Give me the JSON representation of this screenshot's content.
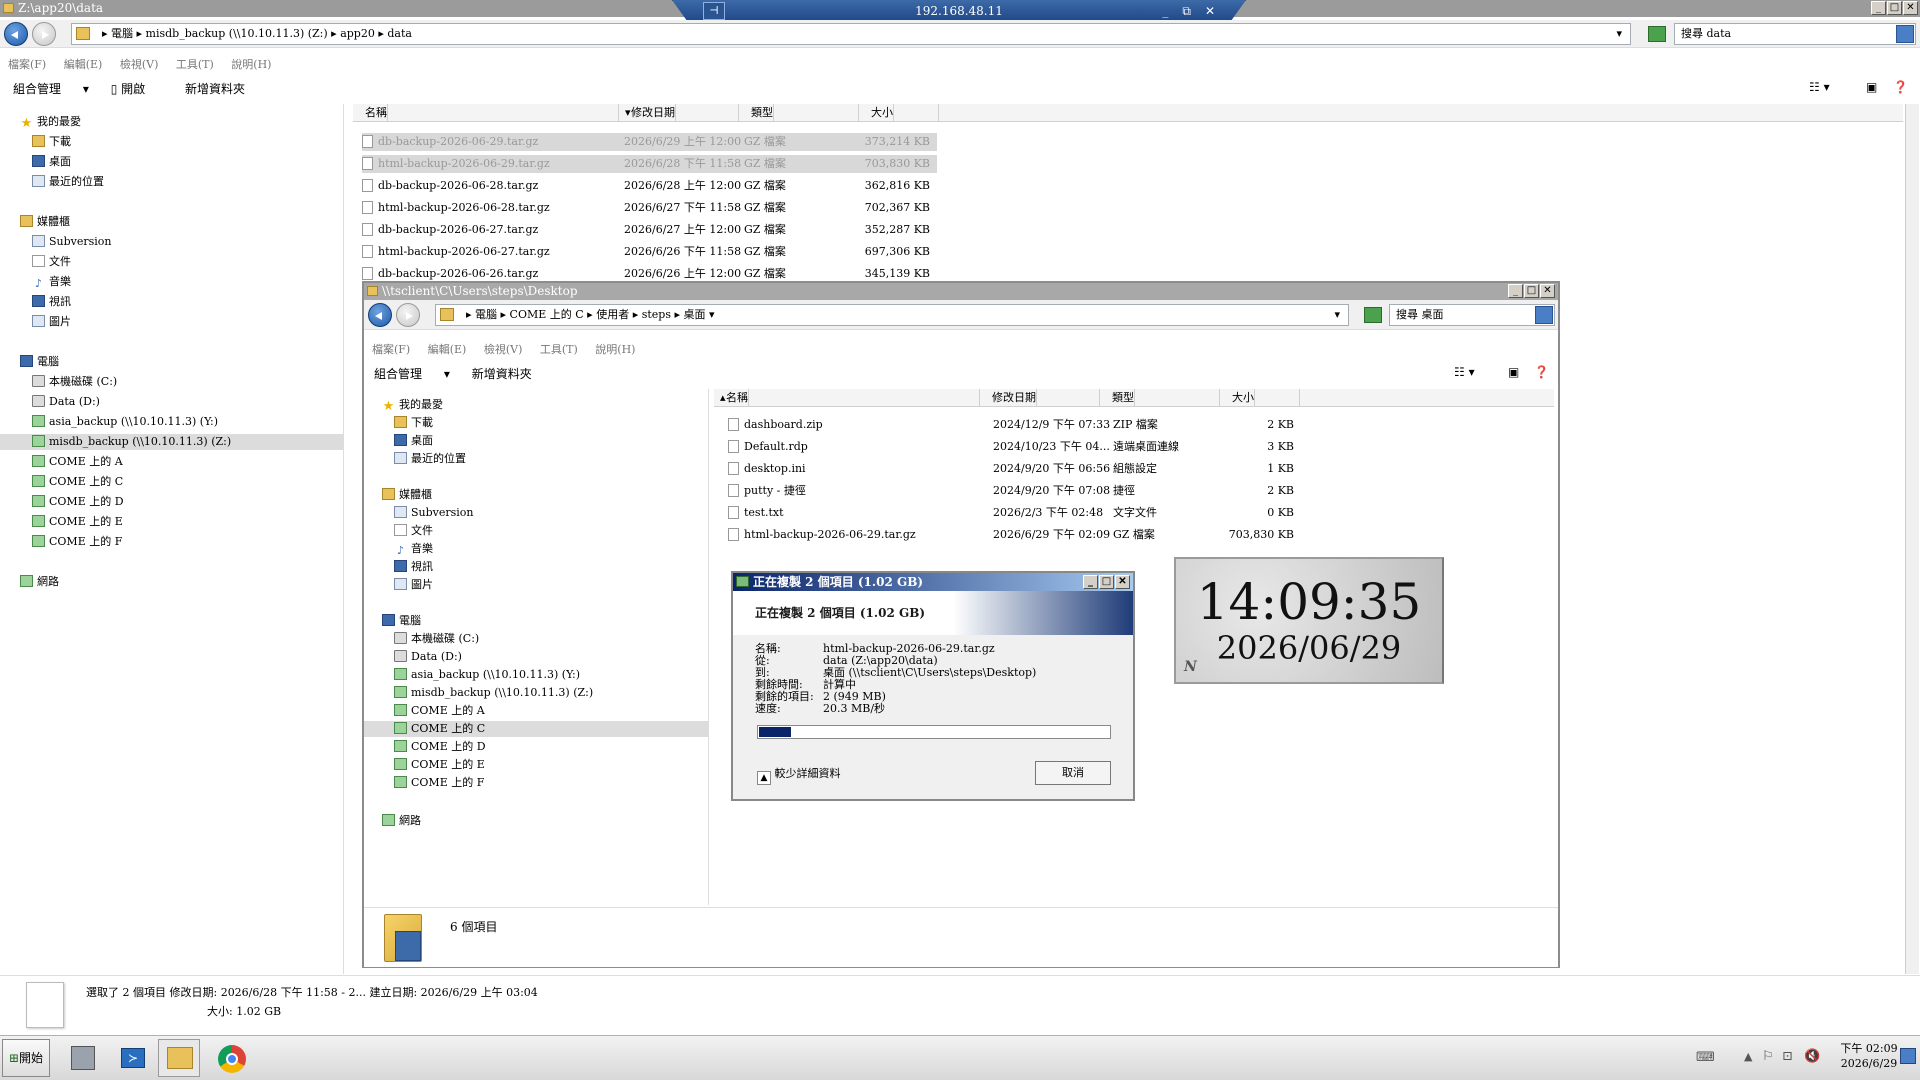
{
  "outer_window": {
    "title": "Z:\\app20\\data",
    "breadcrumb": [
      "電腦",
      "misdb_backup (\\\\10.10.11.3) (Z:)",
      "app20",
      "data"
    ],
    "search_placeholder": "搜尋 data",
    "menu": [
      "檔案(F)",
      "編輯(E)",
      "檢視(V)",
      "工具(T)",
      "說明(H)"
    ],
    "toolbar": {
      "organize": "組合管理",
      "open": "開啟",
      "new_folder": "新增資料夾"
    },
    "nav": {
      "favorites": "我的最愛",
      "favorites_items": [
        "下載",
        "桌面",
        "最近的位置"
      ],
      "libraries": "媒體櫃",
      "libraries_items": [
        "Subversion",
        "文件",
        "音樂",
        "視訊",
        "圖片"
      ],
      "computer": "電腦",
      "computer_items": [
        "本機磁碟 (C:)",
        "Data (D:)",
        "asia_backup (\\\\10.10.11.3) (Y:)",
        "misdb_backup (\\\\10.10.11.3) (Z:)",
        "COME 上的 A",
        "COME 上的 C",
        "COME 上的 D",
        "COME 上的 E",
        "COME 上的 F"
      ],
      "network": "網路"
    },
    "columns": [
      "名稱",
      "修改日期",
      "類型",
      "大小"
    ],
    "files": [
      {
        "name": "db-backup-2026-06-29.tar.gz",
        "date": "2026/6/29 上午 12:00",
        "type": "GZ 檔案",
        "size": "373,214 KB",
        "selected": true
      },
      {
        "name": "html-backup-2026-06-29.tar.gz",
        "date": "2026/6/28 下午 11:58",
        "type": "GZ 檔案",
        "size": "703,830 KB",
        "selected": true
      },
      {
        "name": "db-backup-2026-06-28.tar.gz",
        "date": "2026/6/28 上午 12:00",
        "type": "GZ 檔案",
        "size": "362,816 KB",
        "selected": false
      },
      {
        "name": "html-backup-2026-06-28.tar.gz",
        "date": "2026/6/27 下午 11:58",
        "type": "GZ 檔案",
        "size": "702,367 KB",
        "selected": false
      },
      {
        "name": "db-backup-2026-06-27.tar.gz",
        "date": "2026/6/27 上午 12:00",
        "type": "GZ 檔案",
        "size": "352,287 KB",
        "selected": false
      },
      {
        "name": "html-backup-2026-06-27.tar.gz",
        "date": "2026/6/26 下午 11:58",
        "type": "GZ 檔案",
        "size": "697,306 KB",
        "selected": false
      },
      {
        "name": "db-backup-2026-06-26.tar.gz",
        "date": "2026/6/26 上午 12:00",
        "type": "GZ 檔案",
        "size": "345,139 KB",
        "selected": false
      }
    ],
    "details": {
      "line1": "選取了 2 個項目   修改日期: 2026/6/28 下午 11:58 - 2...   建立日期: 2026/6/29 上午 03:04",
      "line2": "大小: 1.02 GB"
    }
  },
  "rdp_bar": {
    "host": "192.168.48.11"
  },
  "inner_window": {
    "title": "\\\\tsclient\\C\\Users\\steps\\Desktop",
    "breadcrumb": [
      "電腦",
      "COME 上的 C",
      "使用者",
      "steps",
      "桌面"
    ],
    "search_placeholder": "搜尋 桌面",
    "menu": [
      "檔案(F)",
      "編輯(E)",
      "檢視(V)",
      "工具(T)",
      "說明(H)"
    ],
    "toolbar": {
      "organize": "組合管理",
      "new_folder": "新增資料夾"
    },
    "nav": {
      "favorites": "我的最愛",
      "favorites_items": [
        "下載",
        "桌面",
        "最近的位置"
      ],
      "libraries": "媒體櫃",
      "libraries_items": [
        "Subversion",
        "文件",
        "音樂",
        "視訊",
        "圖片"
      ],
      "computer": "電腦",
      "computer_items": [
        "本機磁碟 (C:)",
        "Data (D:)",
        "asia_backup (\\\\10.10.11.3) (Y:)",
        "misdb_backup (\\\\10.10.11.3) (Z:)",
        "COME 上的 A",
        "COME 上的 C",
        "COME 上的 D",
        "COME 上的 E",
        "COME 上的 F"
      ],
      "network": "網路"
    },
    "columns": [
      "名稱",
      "修改日期",
      "類型",
      "大小"
    ],
    "files": [
      {
        "name": "dashboard.zip",
        "date": "2024/12/9 下午 07:33",
        "type": "ZIP 檔案",
        "size": "2 KB"
      },
      {
        "name": "Default.rdp",
        "date": "2024/10/23 下午 04...",
        "type": "遠端桌面連線",
        "size": "3 KB"
      },
      {
        "name": "desktop.ini",
        "date": "2024/9/20 下午 06:56",
        "type": "組態設定",
        "size": "1 KB"
      },
      {
        "name": "putty - 捷徑",
        "date": "2024/9/20 下午 07:08",
        "type": "捷徑",
        "size": "2 KB"
      },
      {
        "name": "test.txt",
        "date": "2026/2/3 下午 02:48",
        "type": "文字文件",
        "size": "0 KB"
      },
      {
        "name": "html-backup-2026-06-29.tar.gz",
        "date": "2026/6/29 下午 02:09",
        "type": "GZ 檔案",
        "size": "703,830 KB"
      }
    ],
    "status": "6 個項目"
  },
  "copy_dialog": {
    "title": "正在複製 2 個項目 (1.02 GB)",
    "heading": "正在複製 2 個項目 (1.02 GB)",
    "rows": [
      {
        "k": "名稱:",
        "v": "html-backup-2026-06-29.tar.gz"
      },
      {
        "k": "從:",
        "v": "data (Z:\\app20\\data)"
      },
      {
        "k": "到:",
        "v": "桌面 (\\\\tsclient\\C\\Users\\steps\\Desktop)"
      },
      {
        "k": "剩餘時間:",
        "v": "計算中"
      },
      {
        "k": "剩餘的項目:",
        "v": "2 (949 MB)"
      },
      {
        "k": "速度:",
        "v": "20.3 MB/秒"
      }
    ],
    "progress_fraction": 0.09,
    "less_details": "較少詳細資料",
    "cancel": "取消"
  },
  "clock": {
    "time": "14:09:35",
    "date": "2026/06/29",
    "logo": "N"
  },
  "taskbar": {
    "start": "開始",
    "time": "下午 02:09",
    "date": "2026/6/29"
  }
}
